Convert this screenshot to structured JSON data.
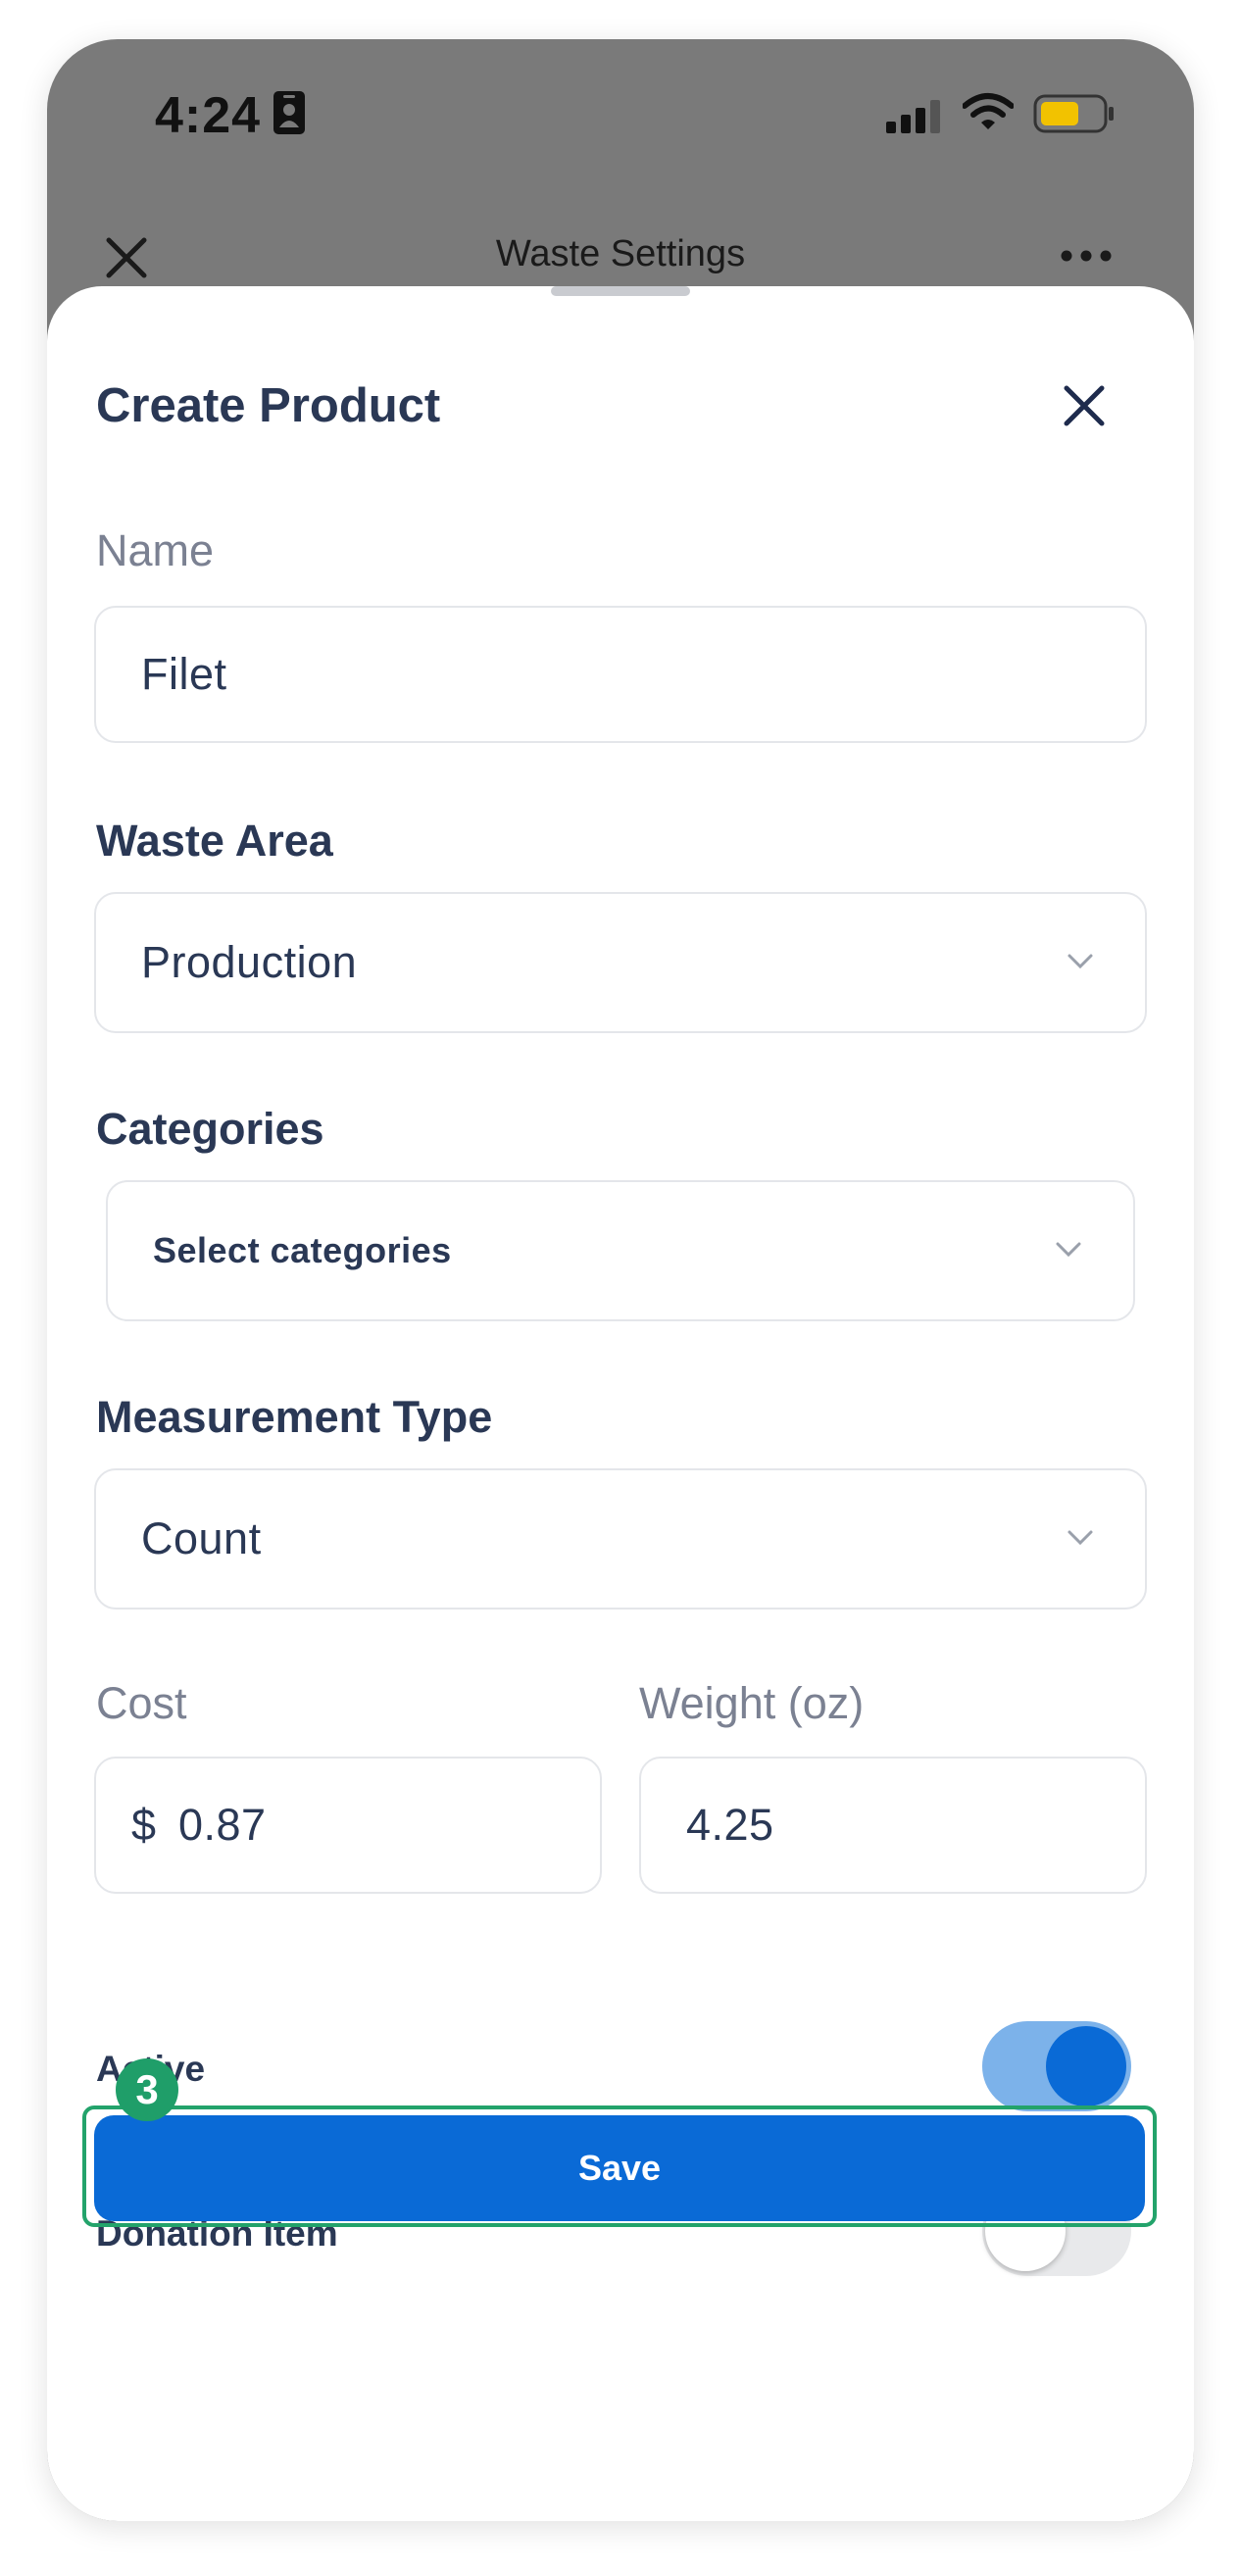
{
  "status_bar": {
    "time": "4:24",
    "icons": [
      "id-badge-icon",
      "signal-icon",
      "wifi-icon",
      "battery-icon"
    ],
    "battery_color": "#f2c200"
  },
  "background_nav": {
    "title": "Waste Settings",
    "left_icon": "close-icon",
    "right_icon": "more-icon"
  },
  "sheet": {
    "title": "Create Product",
    "close_icon": "close-icon",
    "fields": {
      "name": {
        "label": "Name",
        "value": "Filet"
      },
      "waste_area": {
        "label": "Waste Area",
        "value": "Production"
      },
      "categories": {
        "label": "Categories",
        "placeholder": "Select categories"
      },
      "measurement_type": {
        "label": "Measurement Type",
        "value": "Count"
      },
      "cost": {
        "label": "Cost",
        "prefix": "$",
        "value": "0.87"
      },
      "weight": {
        "label": "Weight (oz)",
        "value": "4.25"
      }
    },
    "toggles": {
      "active": {
        "label": "Active",
        "on": true
      },
      "donation_item": {
        "label": "Donation Item",
        "on": false
      }
    },
    "save_label": "Save",
    "step_badge": "3"
  },
  "colors": {
    "primary": "#0a6ad6",
    "highlight": "#23a36b",
    "text": "#2a3855",
    "muted_label": "#7b8192"
  }
}
